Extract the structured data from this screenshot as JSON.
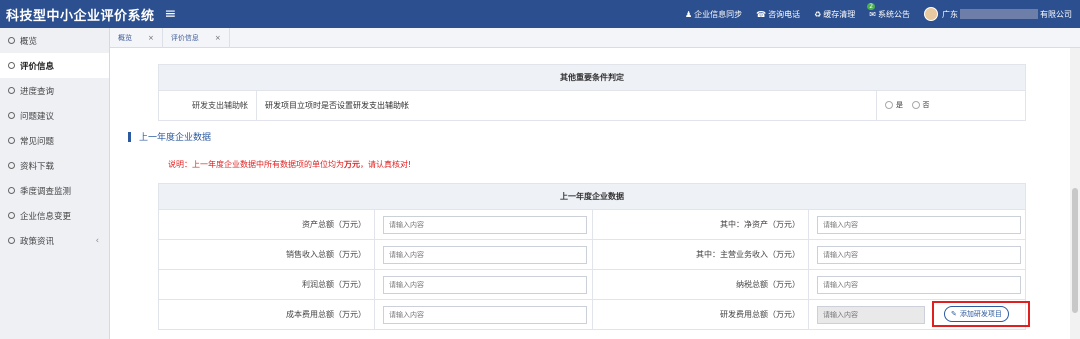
{
  "header": {
    "title": "科技型中小企业评价系统",
    "menu_icon": "≡",
    "actions": [
      {
        "icon": "person-icon",
        "glyph": "♟",
        "label": "企业信息同步"
      },
      {
        "icon": "phone-icon",
        "glyph": "☎",
        "label": "咨询电话"
      },
      {
        "icon": "recycle-icon",
        "glyph": "♻",
        "label": "缓存清理"
      },
      {
        "icon": "mail-icon",
        "glyph": "✉",
        "label": "系统公告",
        "badge": "2"
      }
    ],
    "company_prefix": "广东",
    "company_suffix": "有限公司"
  },
  "sidebar": {
    "items": [
      {
        "label": "概览"
      },
      {
        "label": "评价信息",
        "active": true
      },
      {
        "label": "进度查询"
      },
      {
        "label": "问题建议"
      },
      {
        "label": "常见问题"
      },
      {
        "label": "资料下载"
      },
      {
        "label": "季度调查监测"
      },
      {
        "label": "企业信息变更"
      },
      {
        "label": "政策资讯",
        "chevron": "‹"
      }
    ]
  },
  "tabs": [
    {
      "label": "概览",
      "close": "×"
    },
    {
      "label": "评价信息",
      "close": "×"
    }
  ],
  "other_conditions": {
    "header": "其他重要条件判定",
    "row_label": "研发支出辅助帐",
    "row_question": "研发项目立项时是否设置研发支出辅助帐",
    "yes": "是",
    "no": "否"
  },
  "section_title": "上一年度企业数据",
  "note": {
    "prefix": "说明：上一年度企业数据中所有数据项的单位均为",
    "unit": "万元",
    "suffix": "，请认真核对!"
  },
  "prev_year": {
    "header": "上一年度企业数据",
    "placeholder": "请输入内容",
    "rows": [
      {
        "left_label": "资产总额（万元）",
        "right_label": "其中：净资产（万元）"
      },
      {
        "left_label": "销售收入总额（万元）",
        "right_label": "其中：主营业务收入（万元）"
      },
      {
        "left_label": "利润总额（万元）",
        "right_label": "纳税总额（万元）"
      },
      {
        "left_label": "成本费用总额（万元）",
        "right_label": "研发费用总额（万元）"
      }
    ],
    "add_button": "添加研发项目",
    "add_icon": "✎"
  },
  "colors": {
    "topbar": "#2c4f8f",
    "accent": "#2c5aa0",
    "warning": "#e02020"
  }
}
